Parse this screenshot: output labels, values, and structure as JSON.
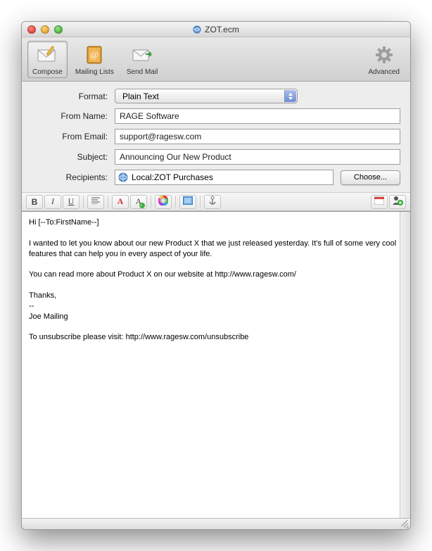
{
  "window": {
    "title": "ZOT.ecm"
  },
  "toolbar": {
    "compose": "Compose",
    "mailing_lists": "Mailing Lists",
    "send_mail": "Send Mail",
    "advanced": "Advanced"
  },
  "form": {
    "format_label": "Format:",
    "format_value": "Plain Text",
    "from_name_label": "From Name:",
    "from_name_value": "RAGE Software",
    "from_email_label": "From Email:",
    "from_email_value": "support@ragesw.com",
    "subject_label": "Subject:",
    "subject_value": "Announcing Our New Product",
    "recipients_label": "Recipients:",
    "recipients_value": "Local:ZOT Purchases",
    "choose_label": "Choose..."
  },
  "formatbar": {
    "bold": "B",
    "italic": "I",
    "underline": "U"
  },
  "body": "Hi [--To:FirstName--]\n\nI wanted to let you know about our new Product X that we just released yesterday. It's full of some very cool features that can help you in every aspect of your life.\n\nYou can read more about Product X on our website at http://www.ragesw.com/\n\nThanks,\n--\nJoe Mailing\n\nTo unsubscribe please visit: http://www.ragesw.com/unsubscribe"
}
